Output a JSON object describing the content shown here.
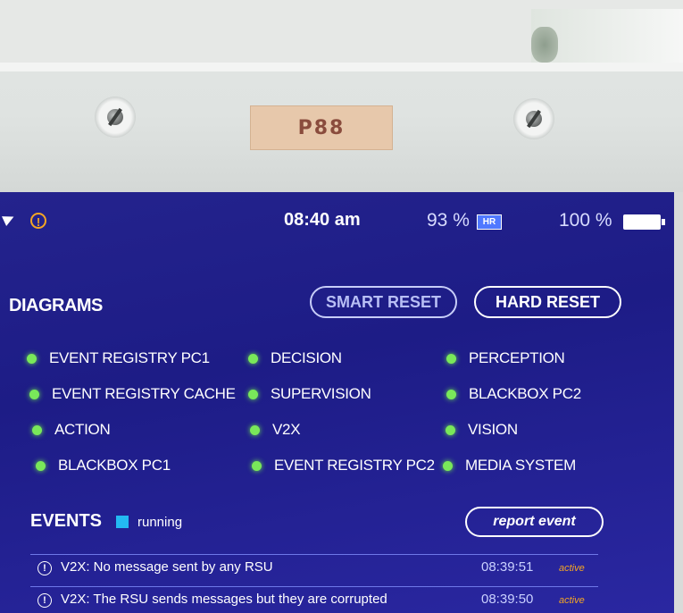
{
  "device": {
    "label": "P88"
  },
  "status_bar": {
    "time": "08:40 am",
    "hr_percent": "93 %",
    "hr_badge": "HR",
    "battery_percent": "100 %",
    "battery_level": 1.0,
    "warning_icon": "warning-circle-icon"
  },
  "diagrams": {
    "title": "DIAGRAMS",
    "smart_reset_label": "SMART RESET",
    "hard_reset_label": "HARD RESET",
    "status_color": "#79e85a",
    "items": [
      {
        "label": "EVENT REGISTRY PC1"
      },
      {
        "label": "DECISION"
      },
      {
        "label": "PERCEPTION"
      },
      {
        "label": "EVENT REGISTRY CACHE"
      },
      {
        "label": "SUPERVISION"
      },
      {
        "label": "BLACKBOX PC2"
      },
      {
        "label": "ACTION"
      },
      {
        "label": "V2X"
      },
      {
        "label": "VISION"
      },
      {
        "label": "BLACKBOX PC1"
      },
      {
        "label": "EVENT REGISTRY PC2"
      },
      {
        "label": "MEDIA SYSTEM"
      }
    ]
  },
  "events": {
    "title": "EVENTS",
    "running_label": "running",
    "running_color": "#23b9f2",
    "report_label": "report event",
    "rows": [
      {
        "message": "V2X: No message sent by any RSU",
        "time": "08:39:51",
        "state": "active"
      },
      {
        "message": "V2X: The RSU sends messages but they are corrupted",
        "time": "08:39:50",
        "state": "active"
      }
    ]
  }
}
